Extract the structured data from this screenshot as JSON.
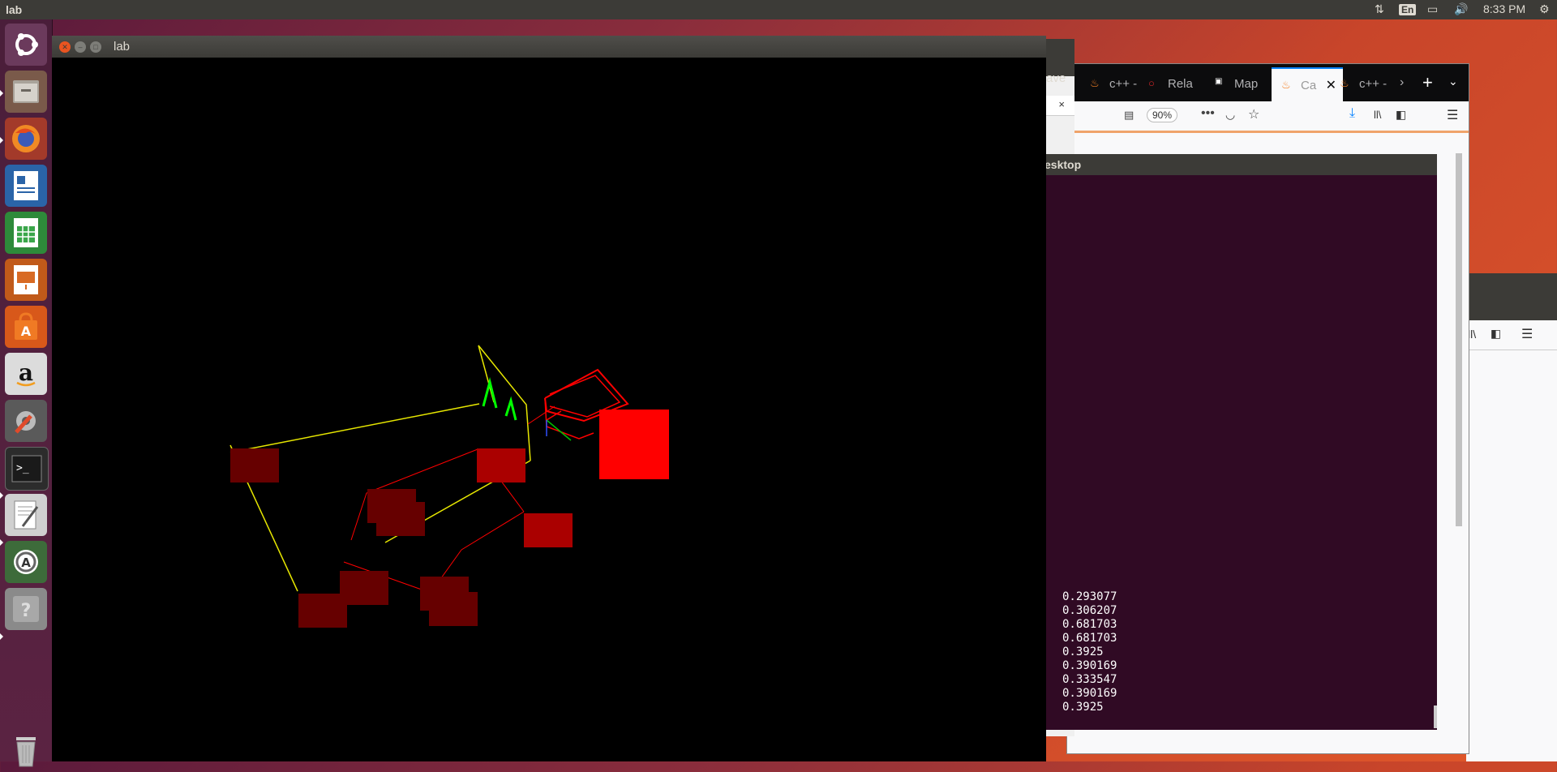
{
  "topbar": {
    "title": "lab",
    "lang": "En",
    "time": "8:33 PM"
  },
  "launcher": {
    "items": [
      {
        "name": "ubuntu-dash-icon"
      },
      {
        "name": "files-icon"
      },
      {
        "name": "firefox-icon"
      },
      {
        "name": "writer-icon"
      },
      {
        "name": "calc-icon"
      },
      {
        "name": "impress-icon"
      },
      {
        "name": "software-center-icon"
      },
      {
        "name": "amazon-icon"
      },
      {
        "name": "settings-icon"
      },
      {
        "name": "terminal-icon"
      },
      {
        "name": "text-editor-icon"
      },
      {
        "name": "updater-icon"
      },
      {
        "name": "help-icon"
      }
    ],
    "trash": "trash-icon"
  },
  "lab_window": {
    "title": "lab"
  },
  "gedit_window": {
    "title_fragment": "ave"
  },
  "terminal": {
    "title_fragment": "esktop",
    "lines": [
      "0.293077",
      "0.306207",
      "0.681703",
      "0.681703",
      "0.3925",
      "0.390169",
      "0.333547",
      "0.390169",
      "0.3925"
    ]
  },
  "firefox": {
    "tabs": [
      {
        "label": "c++ -",
        "icon": "stack-overflow-icon"
      },
      {
        "label": "Rela",
        "icon": "opera-icon"
      },
      {
        "label": "Map",
        "icon": "opengl-icon"
      },
      {
        "label": "Ca",
        "icon": "stack-overflow-icon",
        "active": true
      },
      {
        "label": "c++ -",
        "icon": "stack-overflow-icon"
      }
    ],
    "zoom": "90%"
  },
  "scene": {
    "colors": {
      "yellow": "#e6e600",
      "red": "#ff0000",
      "darkred": "#660000",
      "midred": "#aa0000",
      "green": "#00ff00"
    }
  }
}
